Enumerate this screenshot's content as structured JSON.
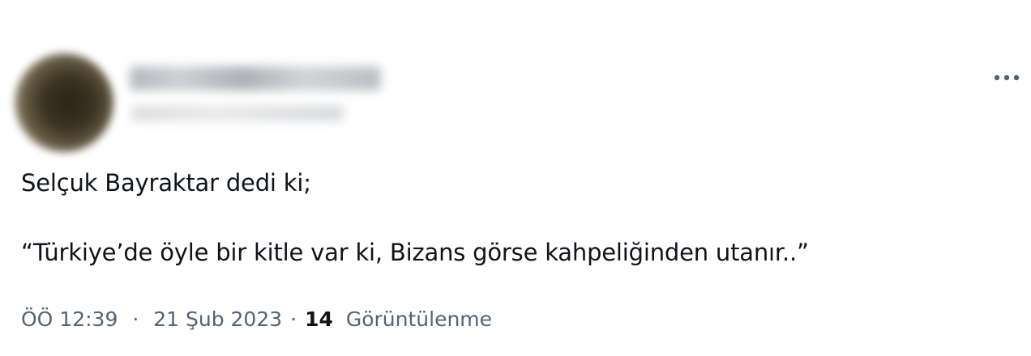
{
  "tweet": {
    "author": {
      "avatar_icon": "avatar-blurred",
      "name_blurred": true,
      "handle_blurred": true
    },
    "more_icon": "more-horizontal-icon",
    "text_lines": [
      "Selçuk Bayraktar dedi ki;",
      "“Türkiye’de öyle bir kitle var ki, Bizans görse kahpeliğinden utanır..”"
    ],
    "meta": {
      "time": "ÖÖ 12:39",
      "separator": "·",
      "date": "21 Şub 2023",
      "views_count": "14",
      "views_label": "Görüntülenme"
    }
  },
  "colors": {
    "text_primary": "#0f1419",
    "text_secondary": "#536471",
    "background": "#ffffff"
  }
}
